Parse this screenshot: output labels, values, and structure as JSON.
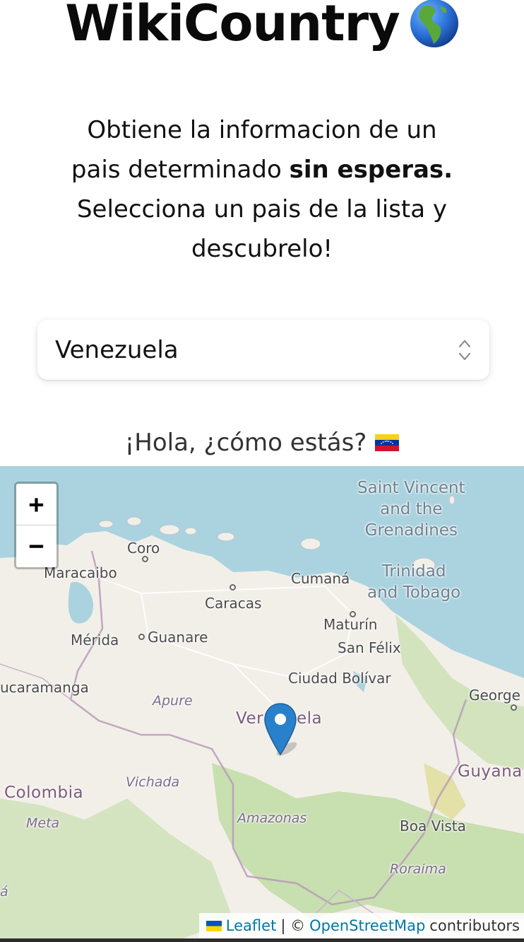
{
  "header": {
    "title": "WikiCountry",
    "title_icon": "globe-americas-icon"
  },
  "intro": {
    "line1": "Obtiene la informacion de un",
    "line2_prefix": "pais determinado ",
    "line2_bold": "sin esperas.",
    "line3": "Selecciona un pais de la lista y",
    "line4": "descubrelo!"
  },
  "country_select": {
    "selected": "Venezuela",
    "icon": "chevron-up-down-icon"
  },
  "greeting": {
    "text": "¡Hola, ¿cómo estás?",
    "flag_icon": "venezuela-flag-icon"
  },
  "map": {
    "zoom_in_label": "+",
    "zoom_out_label": "−",
    "marker_icon": "map-marker-icon",
    "labels": {
      "saint_vincent_1": "Saint Vincent",
      "saint_vincent_2": "and the",
      "saint_vincent_3": "Grenadines",
      "trinidad_1": "Trinidad",
      "trinidad_2": "and Tobago",
      "coro": "Coro",
      "maracaibo": "Maracaibo",
      "caracas": "Caracas",
      "cumana": "Cumaná",
      "maturin": "Maturín",
      "san_felix": "San Félix",
      "merida": "Mérida",
      "guanare": "Guanare",
      "bucaramanga": "ucaramanga",
      "ciudad_bolivar": "Ciudad Bolívar",
      "george": "George",
      "apure": "Apure",
      "venezuela_left": "Ver",
      "venezuela_right": "ela",
      "guyana": "Guyana",
      "vichada": "Vichada",
      "colombia": "Colombia",
      "meta": "Meta",
      "amazonas": "Amazonas",
      "boa_vista": "Boa Vista",
      "roraima": "Roraima",
      "edge_a": "á"
    },
    "attribution": {
      "leaflet": "Leaflet",
      "separator": "| ©",
      "osm": "OpenStreetMap",
      "contributors": "contributors"
    }
  },
  "colors": {
    "sea": "#aad3df",
    "land": "#f2efe9",
    "forest": "#add19e",
    "marker": "#2a81cb",
    "link": "#0078a8"
  }
}
